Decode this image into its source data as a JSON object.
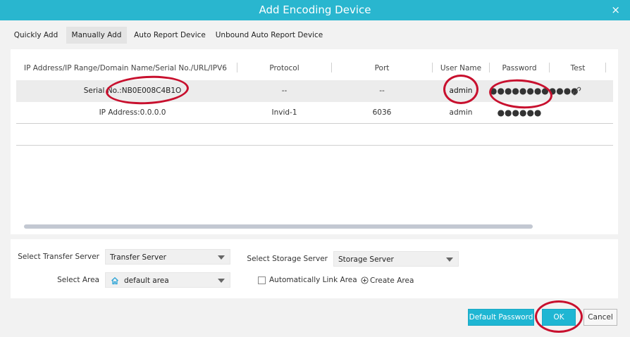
{
  "window": {
    "title": "Add  Encoding Device",
    "close_label": "×"
  },
  "tabs": [
    {
      "label": "Quickly Add"
    },
    {
      "label": "Manually Add"
    },
    {
      "label": "Auto Report Device"
    },
    {
      "label": "Unbound Auto Report Device"
    }
  ],
  "grid": {
    "columns": [
      "IP Address/IP Range/Domain Name/Serial No./URL/IPV6",
      "Protocol",
      "Port",
      "User Name",
      "Password",
      "Test"
    ],
    "rows": [
      {
        "address": "Serial No.:NB0E008C4B1O",
        "protocol": "--",
        "port": "--",
        "user": "admin",
        "password": "●●●●●●●●●●●●"
      },
      {
        "address": "IP Address:0.0.0.0",
        "protocol": "Invid-1",
        "port": "6036",
        "user": "admin",
        "password": "●●●●●●"
      }
    ]
  },
  "settings": {
    "transfer_label": "Select Transfer Server",
    "transfer_value": "Transfer Server",
    "storage_label": "Select Storage Server",
    "storage_value": "Storage Server",
    "area_label": "Select Area",
    "area_value": "default area",
    "auto_link_label": "Automatically Link Area",
    "create_area_label": "Create Area"
  },
  "buttons": {
    "default_password": "Default Password",
    "ok": "OK",
    "cancel": "Cancel"
  },
  "colors": {
    "accent": "#29b6cf",
    "annotation": "#c8102e"
  }
}
